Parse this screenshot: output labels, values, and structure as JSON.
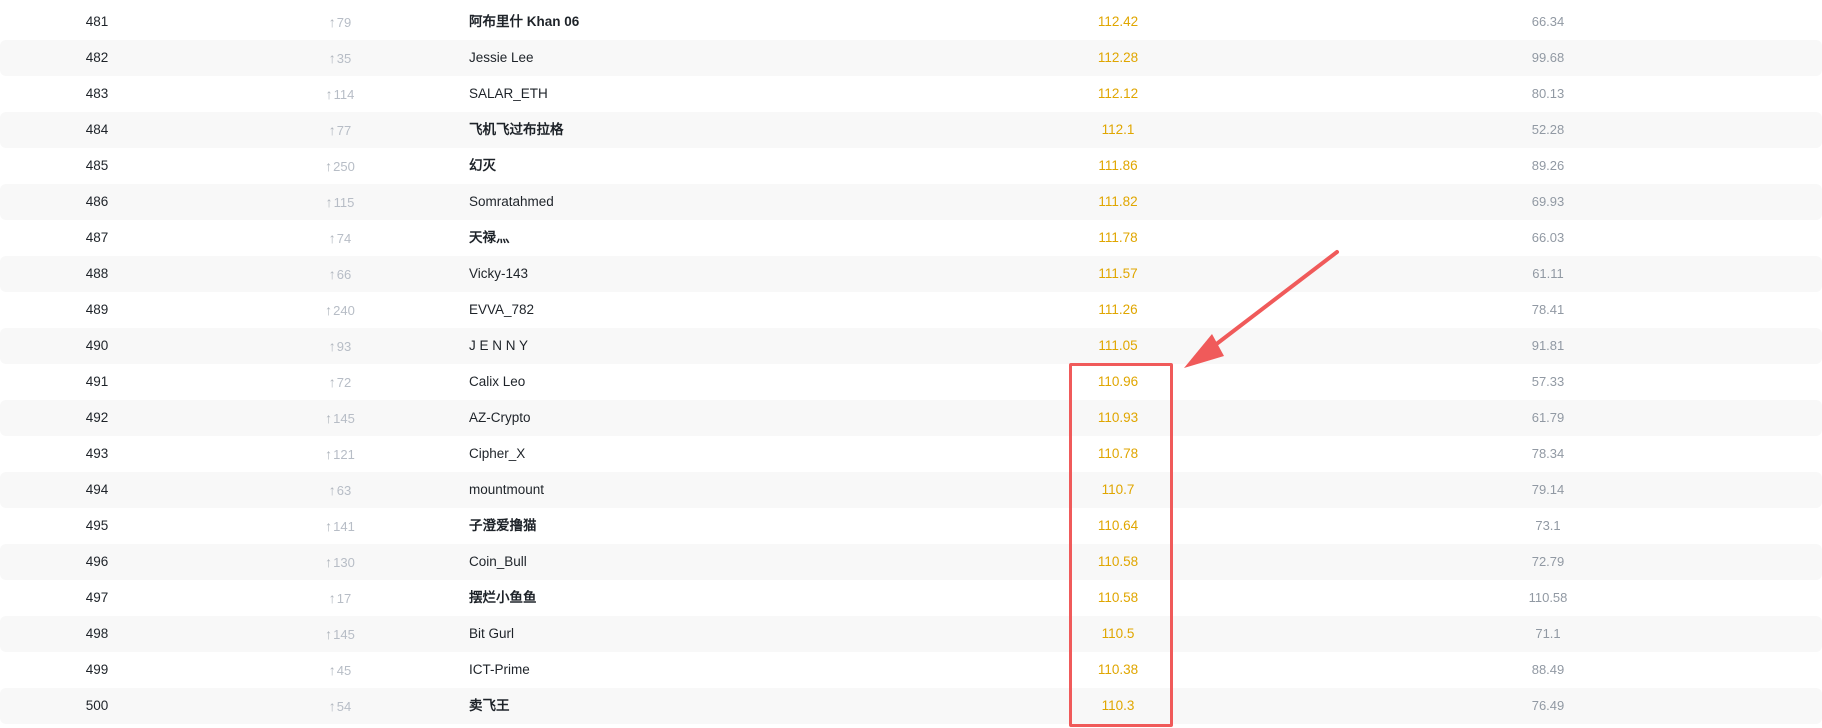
{
  "leaderboard": {
    "rows": [
      {
        "rank": "481",
        "change": "79",
        "name": "阿布里什 Khan 06",
        "cjk": true,
        "score": "112.42",
        "other": "66.34"
      },
      {
        "rank": "482",
        "change": "35",
        "name": "Jessie Lee",
        "cjk": false,
        "score": "112.28",
        "other": "99.68"
      },
      {
        "rank": "483",
        "change": "114",
        "name": "SALAR_ETH",
        "cjk": false,
        "score": "112.12",
        "other": "80.13"
      },
      {
        "rank": "484",
        "change": "77",
        "name": "飞机飞过布拉格",
        "cjk": true,
        "score": "112.1",
        "other": "52.28"
      },
      {
        "rank": "485",
        "change": "250",
        "name": "幻灭",
        "cjk": true,
        "score": "111.86",
        "other": "89.26"
      },
      {
        "rank": "486",
        "change": "115",
        "name": "Somratahmed",
        "cjk": false,
        "score": "111.82",
        "other": "69.93"
      },
      {
        "rank": "487",
        "change": "74",
        "name": "天禄灬",
        "cjk": true,
        "score": "111.78",
        "other": "66.03"
      },
      {
        "rank": "488",
        "change": "66",
        "name": "Vicky-143",
        "cjk": false,
        "score": "111.57",
        "other": "61.11"
      },
      {
        "rank": "489",
        "change": "240",
        "name": "EVVA_782",
        "cjk": false,
        "score": "111.26",
        "other": "78.41"
      },
      {
        "rank": "490",
        "change": "93",
        "name": "J E N N Y",
        "cjk": false,
        "score": "111.05",
        "other": "91.81"
      },
      {
        "rank": "491",
        "change": "72",
        "name": "Calix Leo",
        "cjk": false,
        "score": "110.96",
        "other": "57.33"
      },
      {
        "rank": "492",
        "change": "145",
        "name": "AZ-Crypto",
        "cjk": false,
        "score": "110.93",
        "other": "61.79"
      },
      {
        "rank": "493",
        "change": "121",
        "name": "Cipher_X",
        "cjk": false,
        "score": "110.78",
        "other": "78.34"
      },
      {
        "rank": "494",
        "change": "63",
        "name": "mountmount",
        "cjk": false,
        "score": "110.7",
        "other": "79.14"
      },
      {
        "rank": "495",
        "change": "141",
        "name": "子澄爱撸猫",
        "cjk": true,
        "score": "110.64",
        "other": "73.1"
      },
      {
        "rank": "496",
        "change": "130",
        "name": "Coin_Bull",
        "cjk": false,
        "score": "110.58",
        "other": "72.79"
      },
      {
        "rank": "497",
        "change": "17",
        "name": "摆烂小鱼鱼",
        "cjk": true,
        "score": "110.58",
        "other": "110.58"
      },
      {
        "rank": "498",
        "change": "145",
        "name": "Bit Gurl",
        "cjk": false,
        "score": "110.5",
        "other": "71.1"
      },
      {
        "rank": "499",
        "change": "45",
        "name": "ICT-Prime",
        "cjk": false,
        "score": "110.38",
        "other": "88.49"
      },
      {
        "rank": "500",
        "change": "54",
        "name": "卖飞王",
        "cjk": true,
        "score": "110.3",
        "other": "76.49"
      }
    ]
  },
  "icons": {
    "rank_change": "arrow-up-icon",
    "annotation": "arrow-pointer-icon"
  },
  "colors": {
    "score": "#e0a600",
    "annotation": "#f05a5a",
    "row_shade": "#f8f8f8"
  }
}
